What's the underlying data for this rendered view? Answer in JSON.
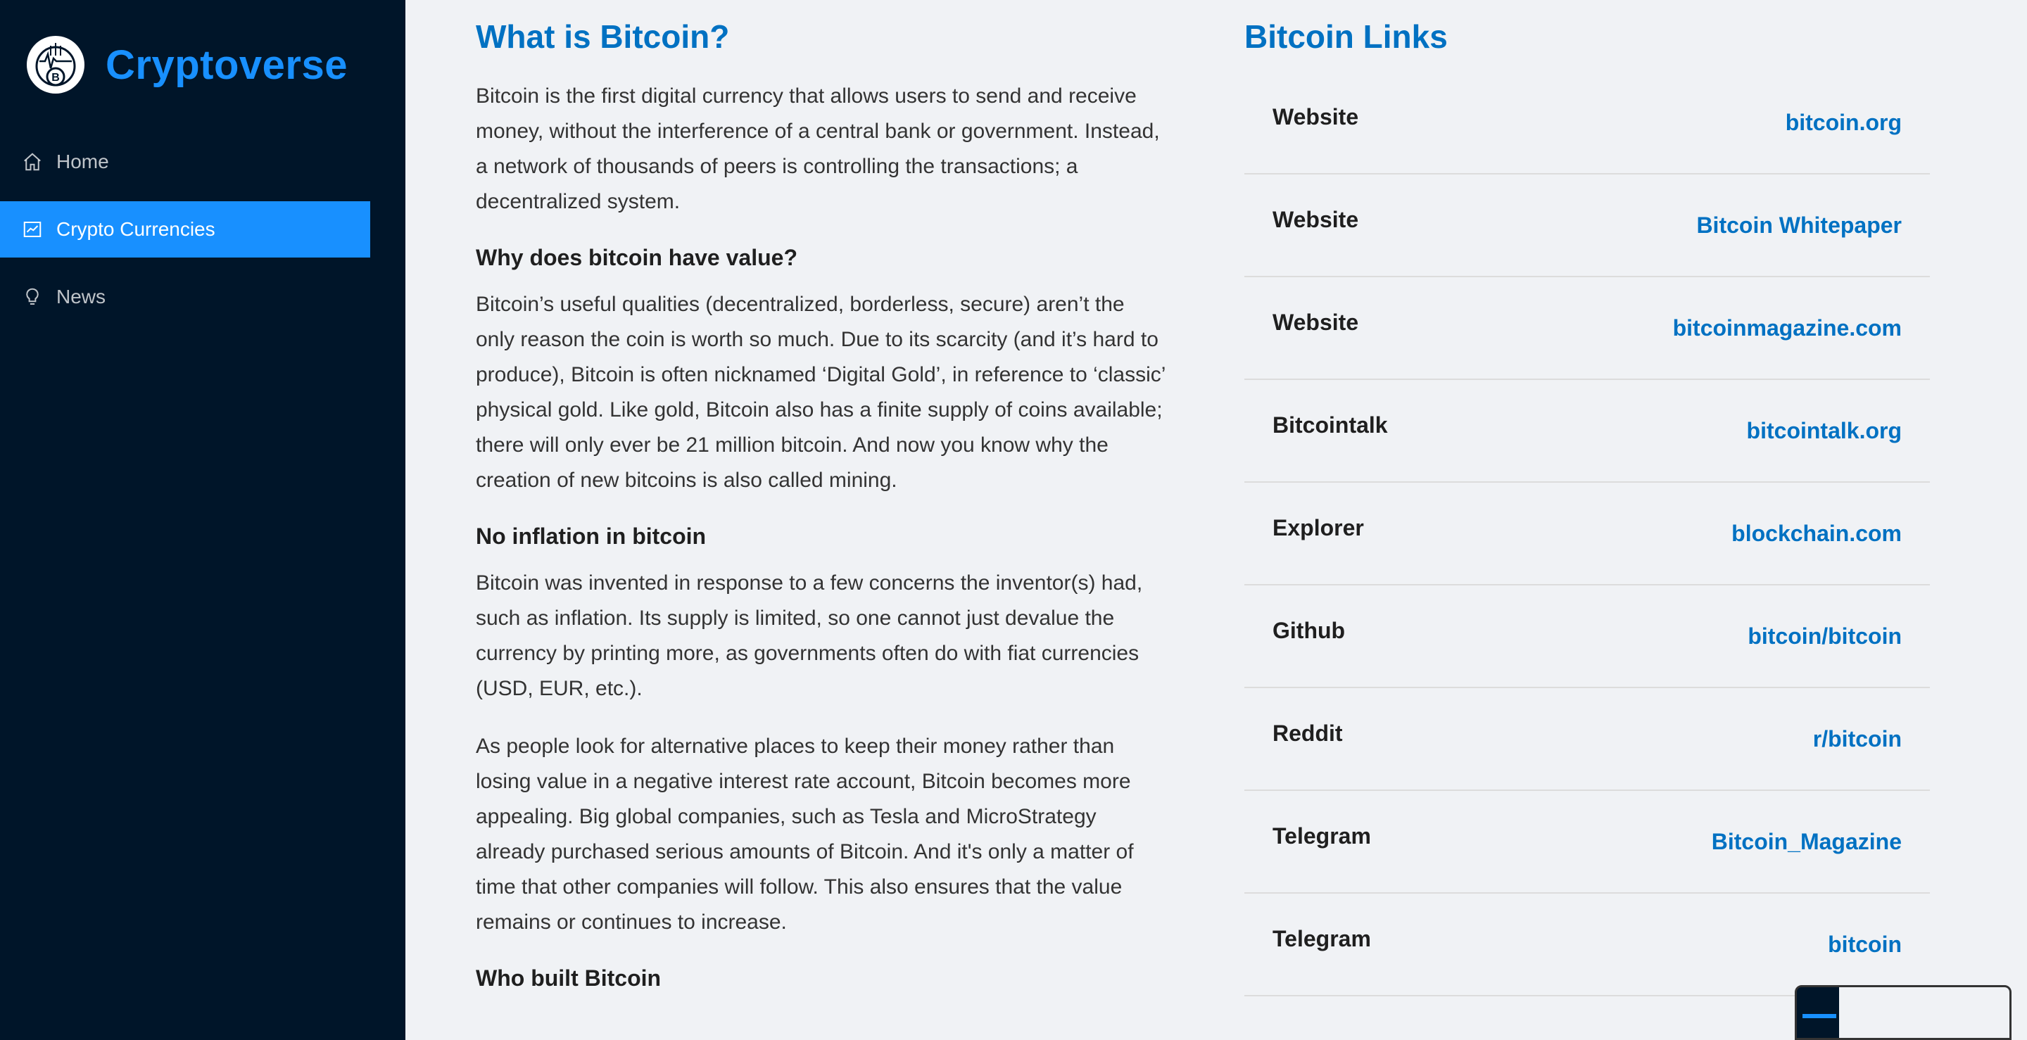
{
  "sidebar": {
    "app_title": "Cryptoverse",
    "items": [
      {
        "label": "Home",
        "icon": "home-icon"
      },
      {
        "label": "Crypto Currencies",
        "icon": "chart-icon",
        "active": true
      },
      {
        "label": "News",
        "icon": "bulb-icon"
      }
    ]
  },
  "description": {
    "title": "What is Bitcoin?",
    "intro": "Bitcoin is the first digital currency that allows users to send and receive money, without the interference of a central bank or government. Instead, a network of thousands of peers is controlling the transactions; a decentralized system.",
    "value_heading": "Why does bitcoin have value?",
    "value_text": "Bitcoin’s useful qualities (decentralized, borderless, secure) aren’t the only reason the coin is worth so much. Due to its scarcity (and it’s hard to produce), Bitcoin is often nicknamed ‘Digital Gold’, in reference to ‘classic’ physical gold. Like gold, Bitcoin also has a finite supply of coins available; there will only ever be 21 million bitcoin. And now you know why the creation of new bitcoins is also called mining.",
    "inflation_heading": "No inflation in bitcoin",
    "inflation_text_1": "Bitcoin was invented in response to a few concerns the inventor(s) had, such as inflation. Its supply is limited, so one cannot just devalue the currency by printing more, as governments often do with fiat currencies (USD, EUR, etc.).",
    "inflation_text_2": "As people look for alternative places to keep their money rather than losing value in a negative interest rate account, Bitcoin becomes more appealing. Big global companies, such as Tesla and MicroStrategy already purchased serious amounts of Bitcoin. And it's only a matter of time that other companies will follow. This also ensures that the value remains or continues to increase.",
    "builder_heading": "Who built Bitcoin"
  },
  "links": {
    "title": "Bitcoin Links",
    "rows": [
      {
        "label": "Website",
        "value": "bitcoin.org"
      },
      {
        "label": "Website",
        "value": "Bitcoin Whitepaper"
      },
      {
        "label": "Website",
        "value": "bitcoinmagazine.com"
      },
      {
        "label": "Bitcointalk",
        "value": "bitcointalk.org"
      },
      {
        "label": "Explorer",
        "value": "blockchain.com"
      },
      {
        "label": "Github",
        "value": "bitcoin/bitcoin"
      },
      {
        "label": "Reddit",
        "value": "r/bitcoin"
      },
      {
        "label": "Telegram",
        "value": "Bitcoin_Magazine"
      },
      {
        "label": "Telegram",
        "value": "bitcoin"
      }
    ]
  },
  "colors": {
    "sidebar_bg": "#001529",
    "accent": "#1890ff",
    "link": "#0071c2",
    "page_bg": "#f0f2f5"
  }
}
